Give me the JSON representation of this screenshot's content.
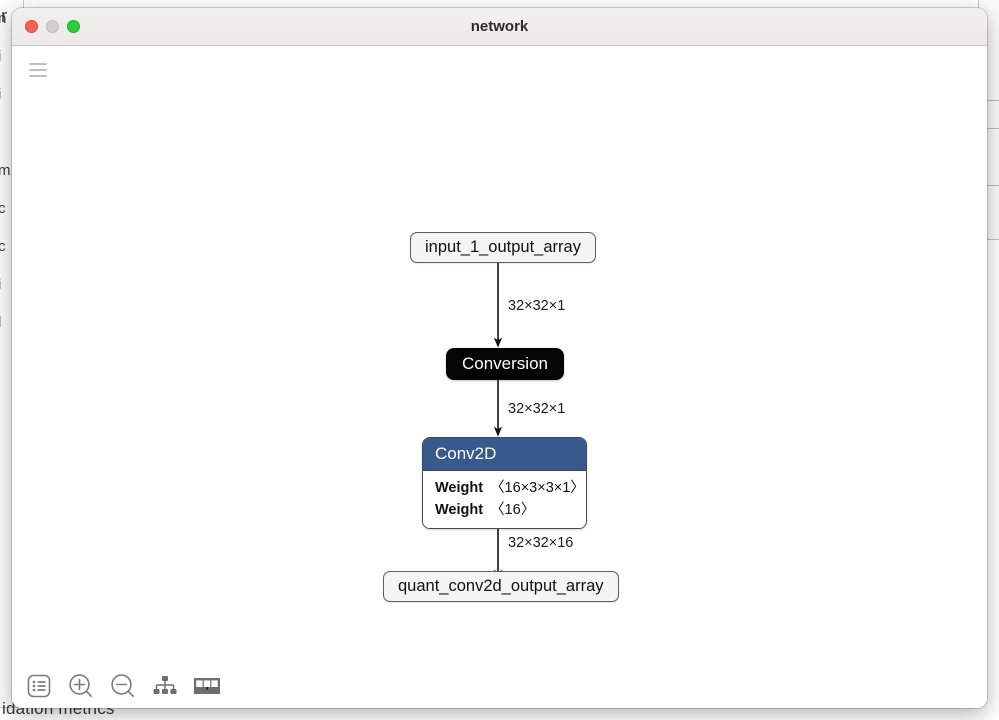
{
  "window": {
    "title": "network",
    "traffic_lights": [
      {
        "name": "close",
        "color": "#fc6058"
      },
      {
        "name": "minimize",
        "color": "#cfcfcf"
      },
      {
        "name": "maximize",
        "color": "#2bcc41"
      }
    ]
  },
  "menu": {
    "icon": "hamburger-menu-icon"
  },
  "graph": {
    "nodes": [
      {
        "id": "input_array",
        "kind": "array",
        "label": "input_1_output_array"
      },
      {
        "id": "conversion",
        "kind": "conversion",
        "label": "Conversion"
      },
      {
        "id": "conv2d",
        "kind": "operation",
        "label": "Conv2D",
        "header_color": "#38598c",
        "attributes": [
          {
            "name": "Weight",
            "value": "〈16×3×3×1〉"
          },
          {
            "name": "Weight",
            "value": "〈16〉"
          }
        ]
      },
      {
        "id": "output_array",
        "kind": "array",
        "label": "quant_conv2d_output_array"
      }
    ],
    "edges": [
      {
        "from": "input_array",
        "to": "conversion",
        "label": "32×32×1"
      },
      {
        "from": "conversion",
        "to": "conv2d",
        "label": "32×32×1"
      },
      {
        "from": "conv2d",
        "to": "output_array",
        "label": "32×32×16"
      }
    ]
  },
  "toolbar": {
    "buttons": [
      {
        "name": "properties-button",
        "icon": "list-icon"
      },
      {
        "name": "zoom-in-button",
        "icon": "zoom-in-icon"
      },
      {
        "name": "zoom-out-button",
        "icon": "zoom-out-icon"
      },
      {
        "name": "hierarchy-button",
        "icon": "hierarchy-icon"
      },
      {
        "name": "layout-button",
        "icon": "panels-icon"
      }
    ]
  },
  "background": {
    "left_column_chars": [
      "n",
      "i",
      "i",
      "",
      "m",
      "c",
      "c",
      "i",
      "l"
    ],
    "bottom_text": "idation metrics",
    "top_left_char": "r"
  }
}
